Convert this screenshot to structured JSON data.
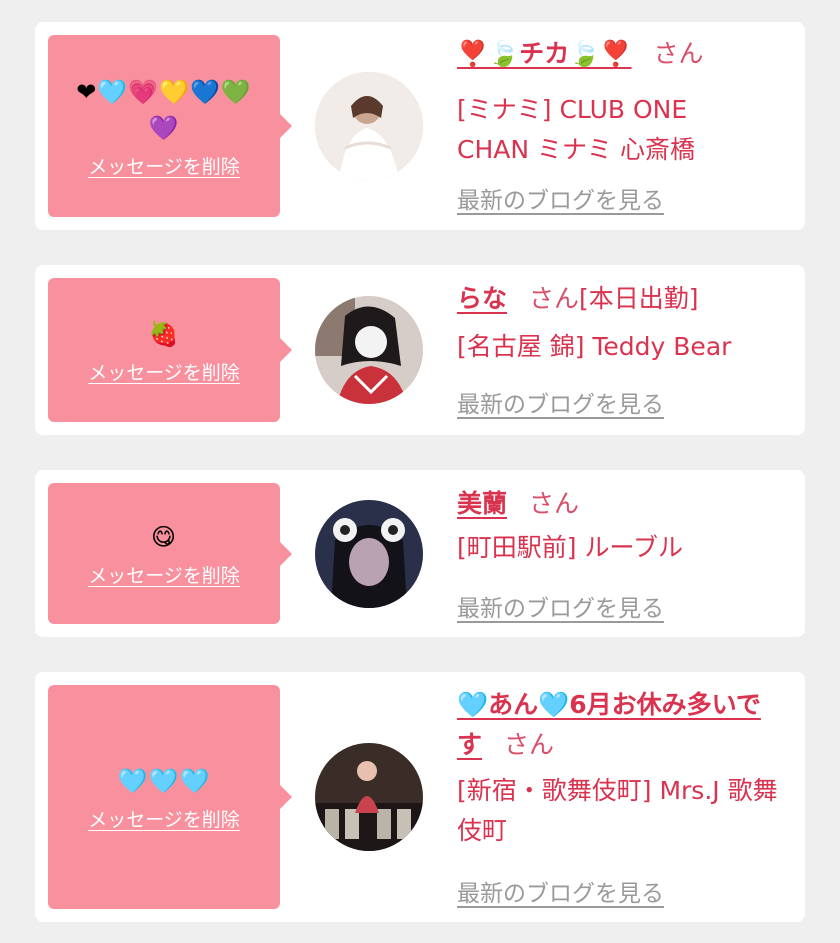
{
  "delete_label": "メッセージを削除",
  "blog_label": "最新のブログを見る",
  "honorific": "さん",
  "cards": [
    {
      "message": "❤🩵💗💛💙💚💜",
      "name": "❣️🍃チカ🍃❣️",
      "tag": "",
      "shop": "[ミナミ] CLUB ONE CHAN ミナミ 心斎橋"
    },
    {
      "message": "🍓",
      "name": "らな",
      "tag": "[本日出勤]",
      "shop": "[名古屋 錦] Teddy Bear"
    },
    {
      "message": "😋",
      "name": "美蘭",
      "tag": "",
      "shop": "[町田駅前] ルーブル"
    },
    {
      "message": "🩵🩵🩵",
      "name": "🩵あん🩵6月お休み多いです",
      "tag": "",
      "shop": "[新宿・歌舞伎町] Mrs.J 歌舞伎町"
    }
  ],
  "colors": {
    "page_bg": "#efefef",
    "bubble": "#f8919d",
    "accent": "#d9334f",
    "muted_link": "#9a9a9a"
  }
}
